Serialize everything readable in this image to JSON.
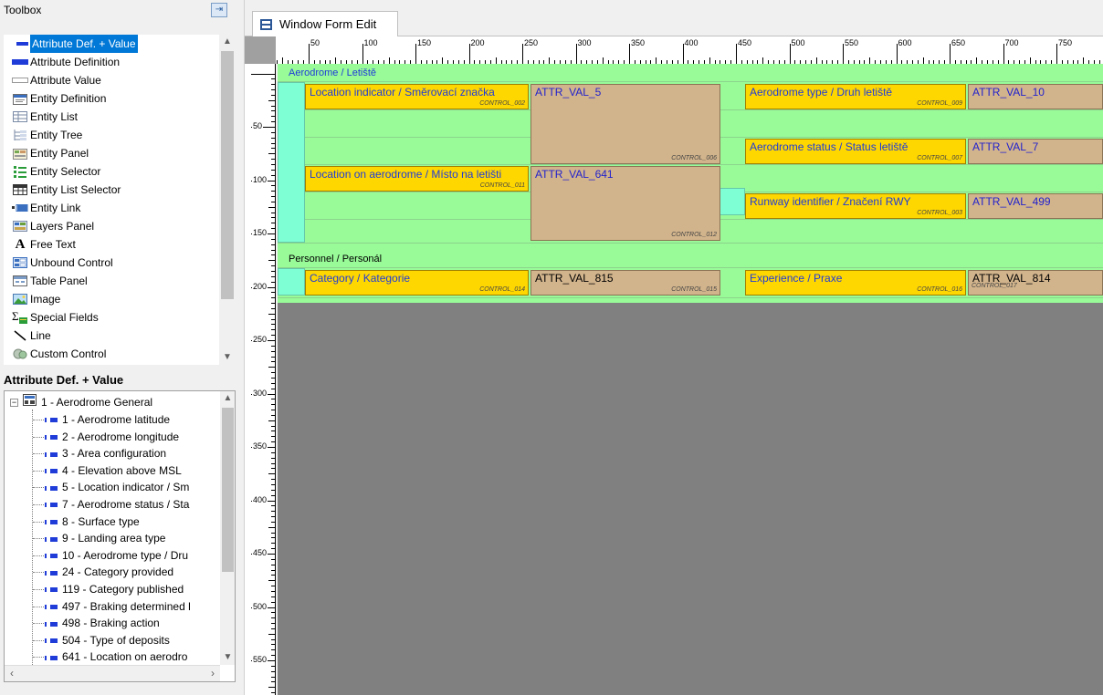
{
  "toolbox": {
    "title": "Toolbox",
    "pin_glyph": "⇥",
    "items": [
      {
        "label": "Attribute Def. + Value",
        "icon": "attribute-def-value-icon",
        "selected": true
      },
      {
        "label": "Attribute Definition",
        "icon": "attribute-definition-icon"
      },
      {
        "label": "Attribute Value",
        "icon": "attribute-value-icon"
      },
      {
        "label": "Entity Definition",
        "icon": "entity-definition-icon"
      },
      {
        "label": "Entity List",
        "icon": "entity-list-icon"
      },
      {
        "label": "Entity Tree",
        "icon": "entity-tree-icon"
      },
      {
        "label": "Entity Panel",
        "icon": "entity-panel-icon"
      },
      {
        "label": "Entity Selector",
        "icon": "entity-selector-icon"
      },
      {
        "label": "Entity List Selector",
        "icon": "entity-list-selector-icon"
      },
      {
        "label": "Entity Link",
        "icon": "entity-link-icon"
      },
      {
        "label": "Layers Panel",
        "icon": "layers-panel-icon"
      },
      {
        "label": "Free Text",
        "icon": "free-text-icon"
      },
      {
        "label": "Unbound Control",
        "icon": "unbound-control-icon"
      },
      {
        "label": "Table Panel",
        "icon": "table-panel-icon"
      },
      {
        "label": "Image",
        "icon": "image-icon"
      },
      {
        "label": "Special Fields",
        "icon": "special-fields-icon"
      },
      {
        "label": "Line",
        "icon": "line-icon"
      },
      {
        "label": "Custom Control",
        "icon": "custom-control-icon"
      }
    ]
  },
  "attr_panel": {
    "title": "Attribute Def. + Value",
    "root": "1 - Aerodrome General",
    "items": [
      "1 - Aerodrome latitude",
      "2 - Aerodrome longitude",
      "3 - Area configuration",
      "4 - Elevation above MSL",
      "5 - Location indicator / Sm",
      "7 - Aerodrome status / Sta",
      "8 - Surface type",
      "9 - Landing area type",
      "10 - Aerodrome type / Dru",
      "24 - Category provided",
      "119 - Category published",
      "497 - Braking determined l",
      "498 - Braking action",
      "504 - Type of deposits",
      "641 - Location on aerodro"
    ]
  },
  "tab": {
    "label": "Window Form Edit",
    "icon": "window-form-icon"
  },
  "ruler_top": [
    "50",
    "100",
    "150",
    "200",
    "250",
    "300",
    "350",
    "400",
    "450",
    "500",
    "550",
    "600",
    "650",
    "700",
    "750"
  ],
  "ruler_left": [
    "50",
    "100",
    "150",
    "200",
    "250",
    "300",
    "350",
    "400",
    "450",
    "500",
    "550"
  ],
  "form": {
    "group1": "Aerodrome / Letiště",
    "group2": "Personnel / Personál",
    "controls": {
      "c002": {
        "label": "Location indicator / Směrovací značka",
        "ctl": "CONTROL_002"
      },
      "c006": {
        "value": "ATTR_VAL_5",
        "ctl": "CONTROL_006"
      },
      "c009": {
        "label": "Aerodrome type / Druh letiště",
        "ctl": "CONTROL_009"
      },
      "c010": {
        "value": "ATTR_VAL_10"
      },
      "c007": {
        "label": "Aerodrome status / Status letiště",
        "ctl": "CONTROL_007"
      },
      "c007v": {
        "value": "ATTR_VAL_7"
      },
      "c011": {
        "label": "Location on aerodrome / Místo na letišti",
        "ctl": "CONTROL_011"
      },
      "c012": {
        "value": "ATTR_VAL_641",
        "ctl": "CONTROL_012"
      },
      "c003": {
        "label": "Runway identifier / Značení RWY",
        "ctl": "CONTROL_003"
      },
      "c003v": {
        "value": "ATTR_VAL_499"
      },
      "c014": {
        "label": "Category / Kategorie",
        "ctl": "CONTROL_014"
      },
      "c015": {
        "value": "ATTR_VAL_815",
        "ctl": "CONTROL_015"
      },
      "c016": {
        "label": "Experience / Praxe",
        "ctl": "CONTROL_016"
      },
      "c017": {
        "value": "ATTR_VAL_814",
        "ctl": "CONTROL_017"
      }
    }
  }
}
